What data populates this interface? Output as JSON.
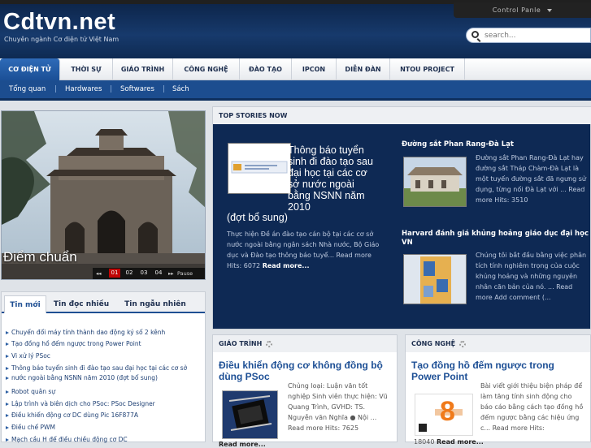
{
  "header": {
    "logo": "Cdtvn.net",
    "tagline": "Chuyên ngành Cơ điện tử Việt Nam",
    "control_panel": "Control Panle",
    "search_placeholder": "search..."
  },
  "nav": {
    "tabs": [
      "CƠ ĐIỆN TỬ",
      "THỜI SỰ",
      "GIÁO TRÌNH",
      "CÔNG NGHỆ",
      "ĐÀO TẠO",
      "IPCON",
      "DIỄN ĐÀN",
      "NTOU PROJECT"
    ],
    "subnav": [
      "Tổng quan",
      "Hardwares",
      "Softwares",
      "Sách"
    ]
  },
  "slider": {
    "caption": "Điểm chuẩn",
    "pages": [
      "01",
      "02",
      "03",
      "04"
    ],
    "pause": "Pause"
  },
  "left_tabs": {
    "tabs": [
      "Tin mới",
      "Tin đọc nhiều",
      "Tin ngẫu nhiên"
    ],
    "items": [
      "Chuyển đổi máy tính thành dao động ký số 2 kênh",
      "Tạo đồng hồ đếm ngược trong Power Point",
      "Vi xử lý PSoc",
      "Thông báo tuyển sinh đi đào tạo sau đại học tại các cơ sở",
      "nước ngoài bằng NSNN năm 2010 (đợt bổ sung)",
      "Robot quân sự",
      "Lập trình và biên dịch cho PSoc: PSoc Designer",
      "Điều khiển động cơ DC dùng Pic 16F877A",
      "Điều chế PWM",
      "Mạch cầu H để điều chiều động cơ DC"
    ]
  },
  "top_stories": {
    "heading": "TOP STORIES NOW",
    "main": {
      "title_line": "Thông báo tuyển sinh đi đào tạo sau đại học tại các cơ sở nước ngoài bằng NSNN năm 2010",
      "title_tail": "(đợt bổ sung)",
      "desc": "Thực hiện Đề án đào tạo cán bộ tại các cơ sở nước ngoài bằng ngân sách Nhà nước, Bộ Giáo dục và Đào tạo thông báo tuyể... Read more Hits: 6072",
      "more": "Read more..."
    },
    "side": [
      {
        "title": "Đường sắt Phan Rang-Đà Lạt",
        "desc": "Đường sắt Phan Rang-Đà Lạt hay đường sắt Tháp Chàm-Đà Lạt là một tuyến đường sắt đã ngưng sử dụng, từng nối Đà Lạt với ... Read more Hits: 3510"
      },
      {
        "title": "Harvard đánh giá khủng hoảng giáo dục đại học VN",
        "desc": "Chúng tôi bắt đầu bằng việc phân tích tính nghiêm trọng của cuộc khủng hoảng và những nguyên nhân căn bản của nó. ... Read more Add comment (..."
      }
    ]
  },
  "modules": [
    {
      "heading": "GIÁO TRÌNH",
      "title": "Điều khiển động cơ không đồng bộ dùng PSoc",
      "desc": "Chủng loại: Luận văn tốt nghiệp Sinh viên thực hiện: Vũ Quang Trình, GVHD: TS. Nguyễn văn Nghĩa ● Nội ... Read more Hits: 7625",
      "more": "Read more..."
    },
    {
      "heading": "CÔNG NGHỆ",
      "title": "Tạo đồng hồ đếm ngược trong Power Point",
      "desc": "Bài viết giới thiệu biện pháp để làm tăng tính sinh động cho báo cáo bằng cách tạo đồng hồ đếm ngược bằng các hiệu ứng c... Read more Hits:",
      "more": "Read more...",
      "hits": "18040",
      "thumb_number": "8"
    }
  ],
  "colors": {
    "header_bg": "#173a6c",
    "nav_active": "#2e6bb8",
    "subnav_bg": "#1c4d8f",
    "stories_bg": "#0e2954",
    "link_blue": "#1d4f95"
  }
}
